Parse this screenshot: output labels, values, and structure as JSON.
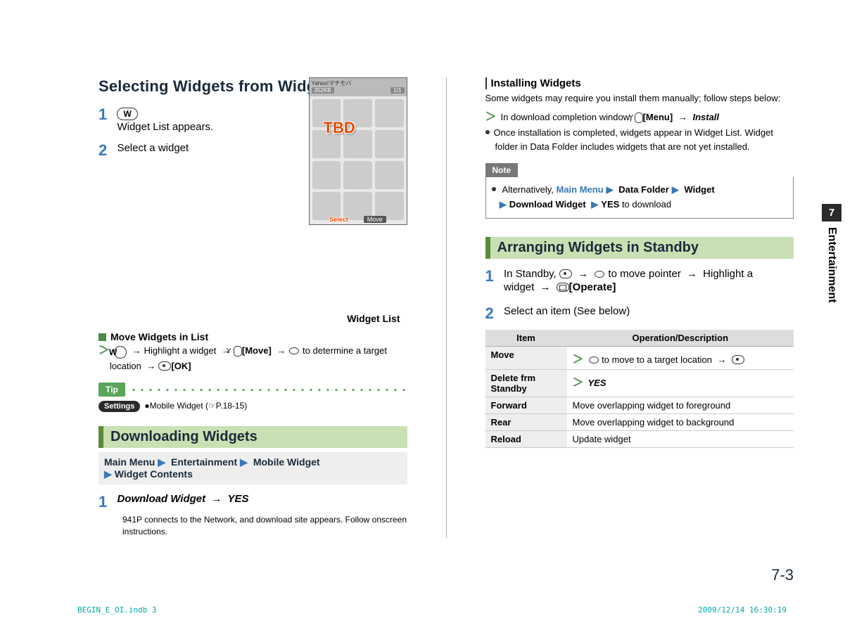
{
  "left": {
    "h_selecting": "Selecting Widgets from Widget List",
    "step1_txt": "Widget List appears.",
    "step1_icon": "W",
    "step2_txt": "Select a widget",
    "screenshot": {
      "title": "Yahoo!マチモバ",
      "size": "352KB",
      "page": "1/1",
      "tbd": "TBD",
      "select": "Select",
      "move": "Move"
    },
    "caption": "Widget List",
    "move_head": "Move Widgets in List",
    "move_flow_icon": "W",
    "move_flow_1": "Highlight a widget",
    "move_flow_btn": "[Move]",
    "move_flow_2": "to determine a target location",
    "move_flow_ok": "[OK]",
    "tip_label": "Tip",
    "settings_label": "Settings",
    "settings_text": "●Mobile Widget (☞P.18-15)",
    "h_download": "Downloading Widgets",
    "crumb": {
      "a": "Main Menu",
      "b": "Entertainment",
      "c": "Mobile Widget",
      "d": "Widget Contents"
    },
    "dl_step1": "Download Widget",
    "dl_yes": "YES",
    "dl_sub": "941P connects to the Network, and download site appears. Follow onscreen instructions."
  },
  "right": {
    "h_install": "Installing Widgets",
    "install_p": "Some widgets may require you install them manually; follow steps below:",
    "install_line1a": "In download completion window,",
    "install_line1_btn": "[Menu]",
    "install_line1_b": "Install",
    "install_bullet": "Once installation is completed, widgets appear in Widget List. Widget folder in Data Folder includes widgets that are not yet installed.",
    "note_label": "Note",
    "note_a": "Alternatively,",
    "note_mm": "Main Menu",
    "note_df": "Data Folder",
    "note_w": "Widget",
    "note_dw": "Download Widget",
    "note_yes": "YES",
    "note_tail": "to download",
    "h_arrange": "Arranging Widgets in Standby",
    "arr1_a": "In Standby,",
    "arr1_b": "to move pointer",
    "arr1_c": "Highlight a widget",
    "arr1_d": "[Operate]",
    "arr2": "Select an item (See below)",
    "table": {
      "th1": "Item",
      "th2": "Operation/Description",
      "rows": [
        {
          "k": "Move",
          "v_pre": "to move to a target location"
        },
        {
          "k": "Delete frm Standby",
          "v": "YES"
        },
        {
          "k": "Forward",
          "v": "Move overlapping widget to foreground"
        },
        {
          "k": "Rear",
          "v": "Move overlapping widget to background"
        },
        {
          "k": "Reload",
          "v": "Update widget"
        }
      ]
    }
  },
  "side": {
    "num": "7",
    "label": "Entertainment"
  },
  "pageno": "7-3",
  "foot_l": "BEGIN_E_OI.indb   3",
  "foot_r": "2009/12/14   16:30:19"
}
